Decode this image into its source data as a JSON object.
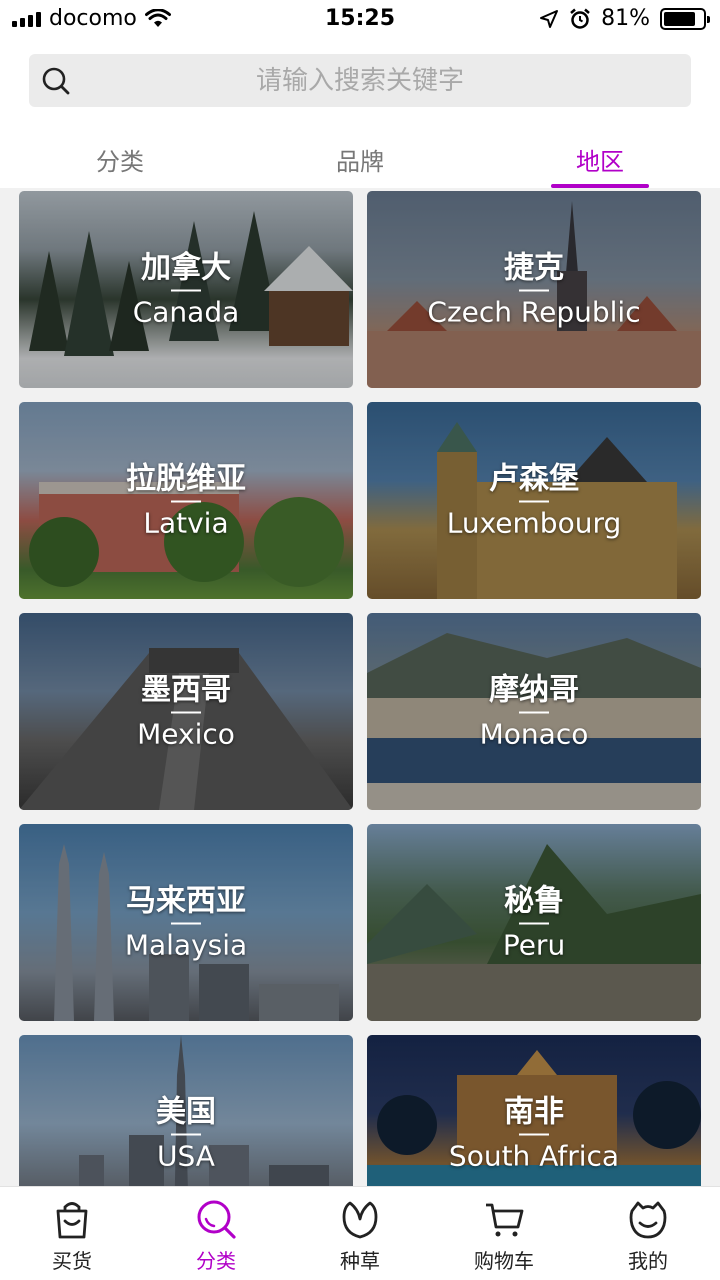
{
  "status_bar": {
    "carrier": "docomo",
    "time": "15:25",
    "battery_percent": "81%",
    "battery_level": 0.81
  },
  "search": {
    "placeholder": "请输入搜索关键字",
    "icon": "search-icon"
  },
  "tabs": [
    {
      "label": "分类",
      "active": false
    },
    {
      "label": "品牌",
      "active": false
    },
    {
      "label": "地区",
      "active": true
    }
  ],
  "regions": [
    {
      "cn": "加拿大",
      "en": "Canada"
    },
    {
      "cn": "捷克",
      "en": "Czech Republic"
    },
    {
      "cn": "拉脱维亚",
      "en": "Latvia"
    },
    {
      "cn": "卢森堡",
      "en": "Luxembourg"
    },
    {
      "cn": "墨西哥",
      "en": "Mexico"
    },
    {
      "cn": "摩纳哥",
      "en": "Monaco"
    },
    {
      "cn": "马来西亚",
      "en": "Malaysia"
    },
    {
      "cn": "秘鲁",
      "en": "Peru"
    },
    {
      "cn": "美国",
      "en": "USA"
    },
    {
      "cn": "南非",
      "en": "South Africa"
    }
  ],
  "bottom_nav": [
    {
      "label": "买货",
      "icon": "shopping-bag-icon",
      "active": false
    },
    {
      "label": "分类",
      "icon": "search-icon",
      "active": true
    },
    {
      "label": "种草",
      "icon": "sprout-icon",
      "active": false
    },
    {
      "label": "购物车",
      "icon": "cart-icon",
      "active": false
    },
    {
      "label": "我的",
      "icon": "profile-face-icon",
      "active": false
    }
  ],
  "colors": {
    "accent": "#b100c8",
    "search_bg": "#ebebeb",
    "grid_bg": "#f1f1f1"
  }
}
